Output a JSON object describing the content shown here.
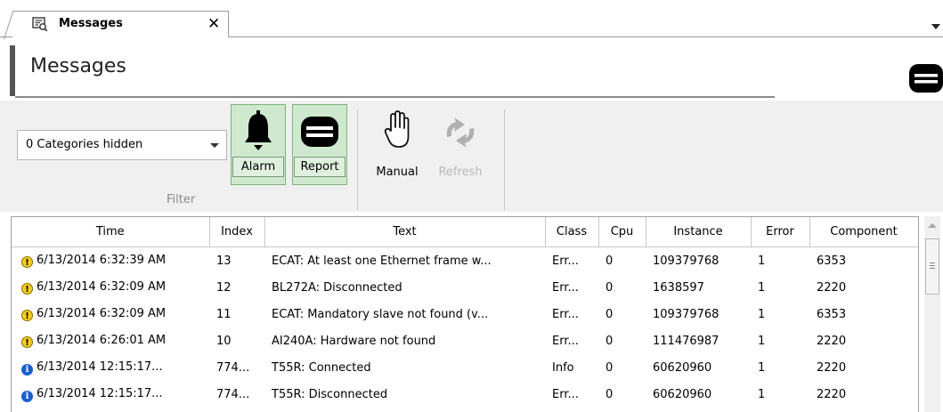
{
  "tab": {
    "title": "Messages",
    "close_glyph": "✕",
    "icon": "messages-doc-icon"
  },
  "header": {
    "title": "Messages",
    "menu_icon": "menu-icon"
  },
  "ribbon": {
    "filter_value": "0 Categories hidden",
    "filter_group_label": "Filter",
    "buttons": {
      "alarm": {
        "label": "Alarm",
        "icon": "bell-icon",
        "toggled": true
      },
      "report": {
        "label": "Report",
        "icon": "report-icon",
        "toggled": true
      },
      "manual": {
        "label": "Manual",
        "icon": "hand-icon"
      },
      "refresh": {
        "label": "Refresh",
        "icon": "refresh-icon",
        "disabled": true
      }
    }
  },
  "table": {
    "columns": [
      "Time",
      "Index",
      "Text",
      "Class",
      "Cpu",
      "Instance",
      "Error",
      "Component"
    ],
    "rows": [
      {
        "severity": "warning",
        "time": "6/13/2014 6:32:39 AM",
        "index": "13",
        "text": "ECAT: At least one Ethernet frame w...",
        "class": "Err...",
        "cpu": "0",
        "instance": "109379768",
        "error": "1",
        "component": "6353"
      },
      {
        "severity": "warning",
        "time": "6/13/2014 6:32:09 AM",
        "index": "12",
        "text": "BL272A: Disconnected",
        "class": "Err...",
        "cpu": "0",
        "instance": "1638597",
        "error": "1",
        "component": "2220"
      },
      {
        "severity": "warning",
        "time": "6/13/2014 6:32:09 AM",
        "index": "11",
        "text": "ECAT: Mandatory slave not found (v...",
        "class": "Err...",
        "cpu": "0",
        "instance": "109379768",
        "error": "1",
        "component": "6353"
      },
      {
        "severity": "warning",
        "time": "6/13/2014 6:26:01 AM",
        "index": "10",
        "text": "AI240A: Hardware not found",
        "class": "Err...",
        "cpu": "0",
        "instance": "111476987",
        "error": "1",
        "component": "2220"
      },
      {
        "severity": "info",
        "time": "6/13/2014 12:15:17...",
        "index": "774...",
        "text": "T55R: Connected",
        "class": "Info",
        "cpu": "0",
        "instance": "60620960",
        "error": "1",
        "component": "2220"
      },
      {
        "severity": "info",
        "time": "6/13/2014 12:15:17...",
        "index": "774...",
        "text": "T55R: Disconnected",
        "class": "Err...",
        "cpu": "0",
        "instance": "60620960",
        "error": "1",
        "component": "2220"
      }
    ]
  },
  "colors": {
    "toggle_bg": "#cfe9cf",
    "warning": "#f6cc1b",
    "info": "#1a5fd0",
    "disabled_text": "#b8b8b8"
  }
}
